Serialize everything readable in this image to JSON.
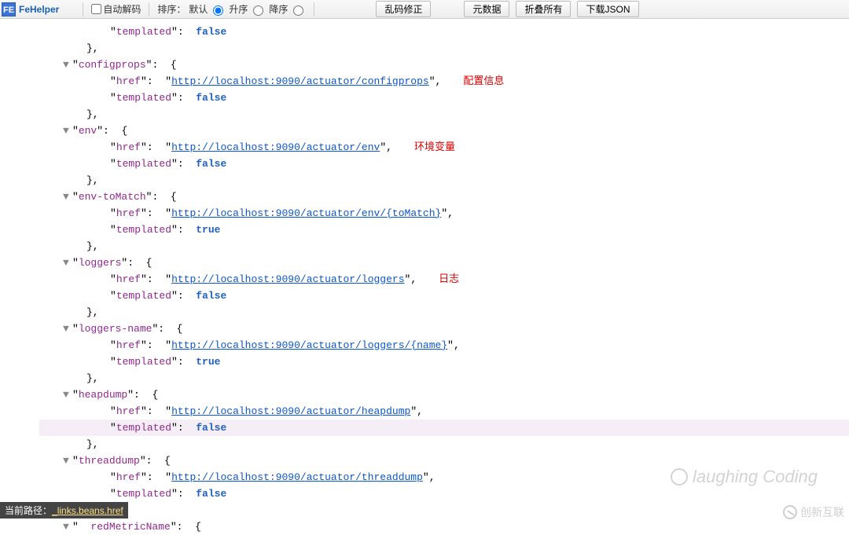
{
  "toolbar": {
    "logo_text": "FE",
    "app_name": "FeHelper",
    "auto_decode": "自动解码",
    "sort_label": "排序：",
    "sort_default": "默认",
    "sort_asc": "升序",
    "sort_desc": "降序",
    "btn_fix": "乱码修正",
    "btn_meta": "元数据",
    "btn_collapse": "折叠所有",
    "btn_download": "下载JSON"
  },
  "tree": {
    "top_templated_key": "templated",
    "top_templated_val": "false",
    "close": "},",
    "caret": "▼",
    "brace_open": "{",
    "nodes": [
      {
        "key": "configprops",
        "href": "http://localhost:9090/actuator/configprops",
        "templated": "false",
        "annot": "配置信息"
      },
      {
        "key": "env",
        "href": "http://localhost:9090/actuator/env",
        "templated": "false",
        "annot": "环境变量"
      },
      {
        "key": "env-toMatch",
        "href_prefix": "http://localhost:9090/actuator/env/",
        "href_param": "{toMatch}",
        "templated": "true"
      },
      {
        "key": "loggers",
        "href": "http://localhost:9090/actuator/loggers",
        "templated": "false",
        "annot": "日志"
      },
      {
        "key": "loggers-name",
        "href_prefix": "http://localhost:9090/actuator/loggers/",
        "href_param": "{name}",
        "templated": "true"
      },
      {
        "key": "heapdump",
        "href": "http://localhost:9090/actuator/heapdump",
        "templated": "false",
        "highlight_templated": true
      },
      {
        "key": "threaddump",
        "href": "http://localhost:9090/actuator/threaddump",
        "templated": "false"
      }
    ],
    "partial_key_suffix": "redMetricName",
    "href_label": "href",
    "templated_label": "templated"
  },
  "status": {
    "label": "当前路径：",
    "path": "_links.beans.href"
  },
  "watermark1": "laughing Coding",
  "watermark2": "创新互联"
}
